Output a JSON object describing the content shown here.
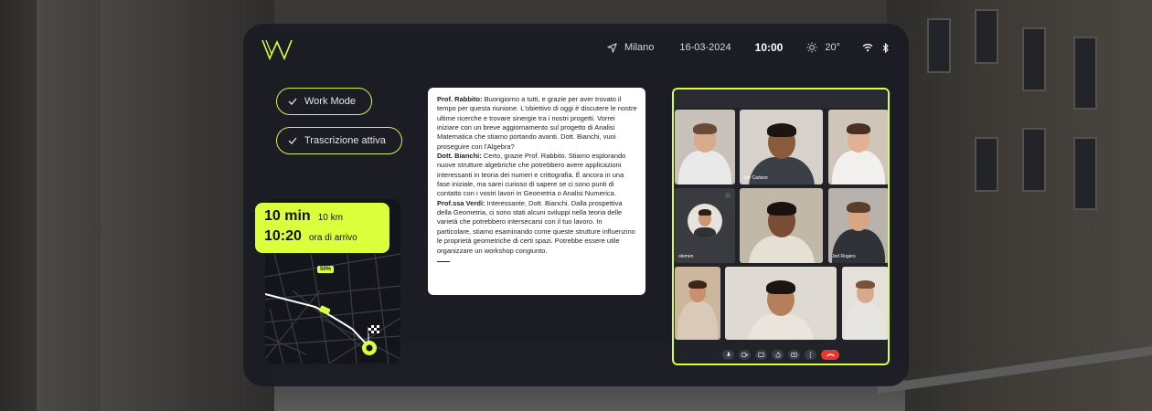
{
  "status_bar": {
    "location": "Milano",
    "date": "16-03-2024",
    "time": "10:00",
    "temperature": "20°"
  },
  "modes": {
    "work_mode_label": "Work Mode",
    "transcription_label": "Trascrizione attiva"
  },
  "navigation": {
    "duration": "10 min",
    "distance": "10 km",
    "arrival_time": "10:20",
    "arrival_label": "ora di arrivo",
    "progress_badge": "50%"
  },
  "transcript": [
    {
      "speaker": "Prof. Rabbito:",
      "text": " Buongiorno a tutti, e grazie per aver trovato il tempo per questa riunione. L'obiettivo di oggi è discutere le nostre ultime ricerche e trovare sinergie tra i nostri progetti. Vorrei iniziare con un breve aggiornamento sul progetto di Analisi Matematica che stiamo portando avanti. Dott. Bianchi, vuoi proseguire con l'Algebra?"
    },
    {
      "speaker": "Dott. Bianchi:",
      "text": " Certo, grazie Prof. Rabbito. Stiamo esplorando nuove strutture algebriche che potrebbero avere applicazioni interessanti in teoria dei numeri e crittografia. È ancora in una fase iniziale, ma sarei curioso di sapere se ci sono punti di contatto con i vostri lavori in Geometria o Analisi Numerica."
    },
    {
      "speaker": "Prof.ssa Verdi:",
      "text": " Interessante, Dott. Bianchi. Dalla prospettiva della Geometria, ci sono stati alcuni sviluppi nella teoria delle varietà che potrebbero intersecarsi con il tuo lavoro. In particolare, stiamo esaminando come queste strutture influenzino le proprietà geometriche di certi spazi. Potrebbe essere utile organizzare un workshop congiunto."
    }
  ],
  "video_call": {
    "participants": [
      {
        "name": "",
        "skin": "#d9a98c",
        "hair": "#6b4a35",
        "shirt": "#e9e9e9",
        "bg": "#c7c1ba"
      },
      {
        "name": "Joe Carlson",
        "skin": "#8a5a3c",
        "hair": "#1c1410",
        "shirt": "#3a3f48",
        "bg": "#d6d2cb"
      },
      {
        "name": "",
        "skin": "#e0b293",
        "hair": "#4a2f22",
        "shirt": "#f2f0ee",
        "bg": "#cfc6b9"
      },
      {
        "name": "olemen",
        "skin": "#c99775",
        "hair": "#2b1f18",
        "shirt": "#2f3136",
        "bg": "#3a3b40"
      },
      {
        "name": "",
        "skin": "#7a4c33",
        "hair": "#1a1210",
        "shirt": "#e6e0d4",
        "bg": "#c2b8a8"
      },
      {
        "name": "Jed Rogers",
        "skin": "#d6a685",
        "hair": "#5a3d2a",
        "shirt": "#2f3338",
        "bg": "#b7b2ab"
      },
      {
        "name": "",
        "skin": "#c98f6f",
        "hair": "#3a2519",
        "shirt": "#d9c9b8",
        "bg": "#cdb79c"
      },
      {
        "name": "",
        "skin": "#b7805d",
        "hair": "#1c1410",
        "shirt": "#e9e4dc",
        "bg": "#dedad3"
      },
      {
        "name": "",
        "skin": "#d7a98a",
        "hair": "#7a5236",
        "shirt": "#e7e5e2",
        "bg": "#e4e1dc"
      }
    ],
    "accent": "#dcff3c",
    "hangup_color": "#e8382d"
  },
  "icons": {
    "logo": "w-logo-icon",
    "location": "navigation-arrow-icon",
    "weather": "sun-icon",
    "wifi": "wifi-icon",
    "bluetooth": "bluetooth-icon",
    "check": "check-icon",
    "finish": "checkered-flag-icon",
    "controls": [
      "mic-icon",
      "camera-icon",
      "captions-icon",
      "raise-hand-icon",
      "present-icon",
      "more-icon",
      "hangup-icon"
    ]
  }
}
